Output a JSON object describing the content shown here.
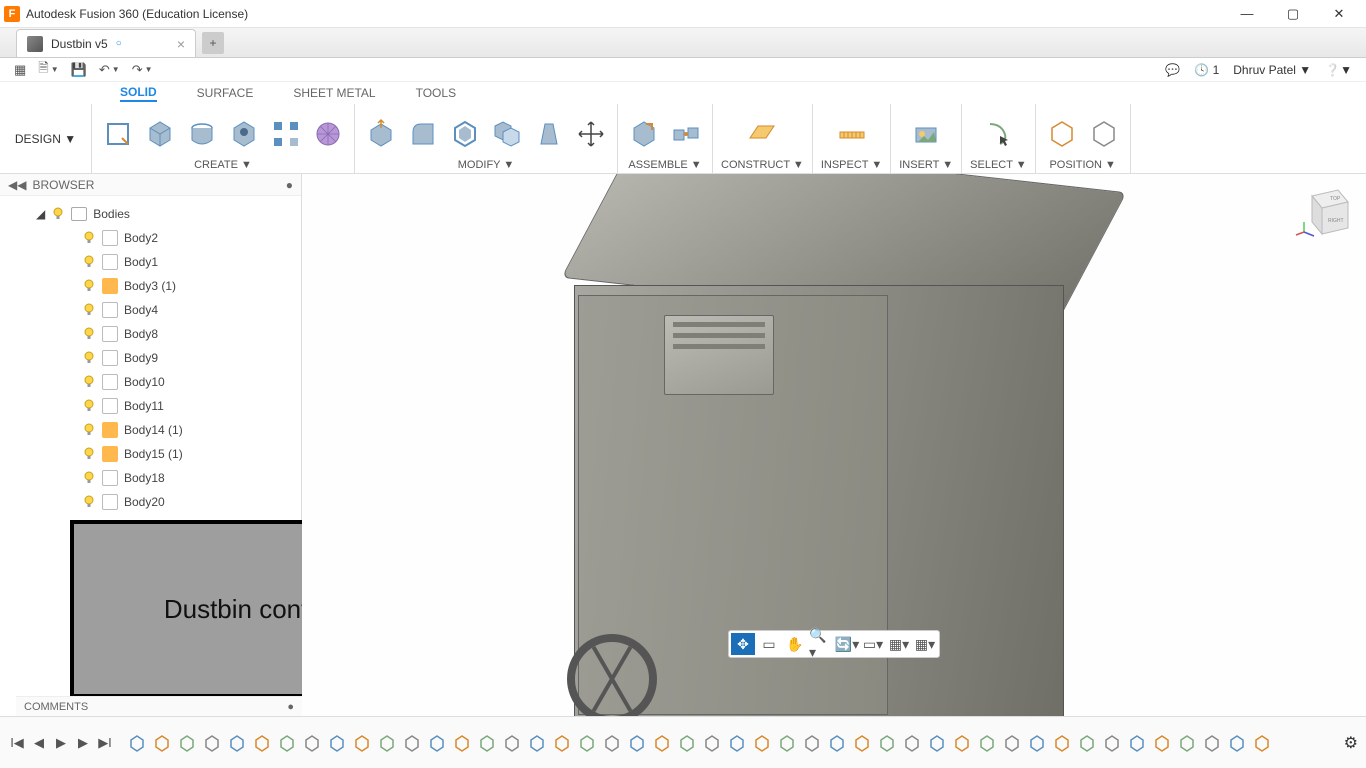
{
  "window": {
    "title": "Autodesk Fusion 360 (Education License)"
  },
  "tab": {
    "name": "Dustbin v5"
  },
  "user": {
    "name": "Dhruv Patel",
    "job_count": "1"
  },
  "workspace": {
    "label": "DESIGN"
  },
  "tool_tabs": [
    "SOLID",
    "SURFACE",
    "SHEET METAL",
    "TOOLS"
  ],
  "ribbon": {
    "create": "CREATE",
    "modify": "MODIFY",
    "assemble": "ASSEMBLE",
    "construct": "CONSTRUCT",
    "inspect": "INSPECT",
    "insert": "INSERT",
    "select": "SELECT",
    "position": "POSITION"
  },
  "browser": {
    "title": "BROWSER",
    "root": "Bodies",
    "items": [
      {
        "label": "Body2",
        "component": false
      },
      {
        "label": "Body1",
        "component": false
      },
      {
        "label": "Body3 (1)",
        "component": true
      },
      {
        "label": "Body4",
        "component": false
      },
      {
        "label": "Body8",
        "component": false
      },
      {
        "label": "Body9",
        "component": false
      },
      {
        "label": "Body10",
        "component": false
      },
      {
        "label": "Body11",
        "component": false
      },
      {
        "label": "Body14 (1)",
        "component": true
      },
      {
        "label": "Body15 (1)",
        "component": true
      },
      {
        "label": "Body18",
        "component": false
      },
      {
        "label": "Body20",
        "component": false
      }
    ]
  },
  "annotation": {
    "text": "Dustbin controller"
  },
  "comments": {
    "label": "COMMENTS"
  },
  "timeline_count": 46
}
